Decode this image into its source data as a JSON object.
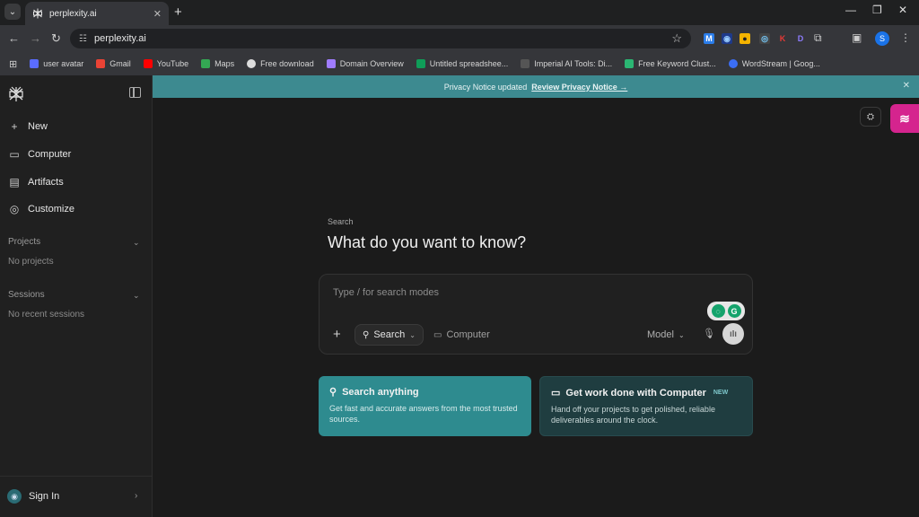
{
  "browser": {
    "tab_title": "perplexity.ai",
    "url": "perplexity.ai",
    "bookmarks": [
      {
        "label": "user avatar",
        "color": "#5a6cff"
      },
      {
        "label": "Gmail",
        "color": "#ea4335"
      },
      {
        "label": "YouTube",
        "color": "#ff0000"
      },
      {
        "label": "Maps",
        "color": "#34a853"
      },
      {
        "label": "Free download",
        "color": "#dddddd"
      },
      {
        "label": "Domain Overview",
        "color": "#a07cff"
      },
      {
        "label": "Untitled spreadshee...",
        "color": "#0f9d58"
      },
      {
        "label": "Imperial AI Tools: Di...",
        "color": "#555555"
      },
      {
        "label": "Free Keyword Clust...",
        "color": "#2bb673"
      },
      {
        "label": "WordStream | Goog...",
        "color": "#3b6ef5"
      }
    ],
    "profile_initial": "S"
  },
  "sidebar": {
    "items": [
      {
        "label": "New",
        "icon": "plus-icon"
      },
      {
        "label": "Computer",
        "icon": "computer-icon"
      },
      {
        "label": "Artifacts",
        "icon": "artifacts-icon"
      },
      {
        "label": "Customize",
        "icon": "customize-icon"
      }
    ],
    "projects": {
      "title": "Projects",
      "empty": "No projects"
    },
    "sessions": {
      "title": "Sessions",
      "empty": "No recent sessions"
    },
    "signin_label": "Sign In"
  },
  "notice": {
    "text": "Privacy Notice updated",
    "link": "Review Privacy Notice →"
  },
  "hero": {
    "label": "Search",
    "title": "What do you want to know?"
  },
  "composer": {
    "placeholder": "Type / for search modes",
    "mode_search": "Search",
    "mode_computer": "Computer",
    "model_label": "Model"
  },
  "cards": [
    {
      "title": "Search anything",
      "desc": "Get fast and accurate answers from the most trusted sources."
    },
    {
      "title": "Get work done with Computer",
      "badge": "NEW",
      "desc": "Hand off your projects to get polished, reliable deliverables around the clock."
    }
  ]
}
